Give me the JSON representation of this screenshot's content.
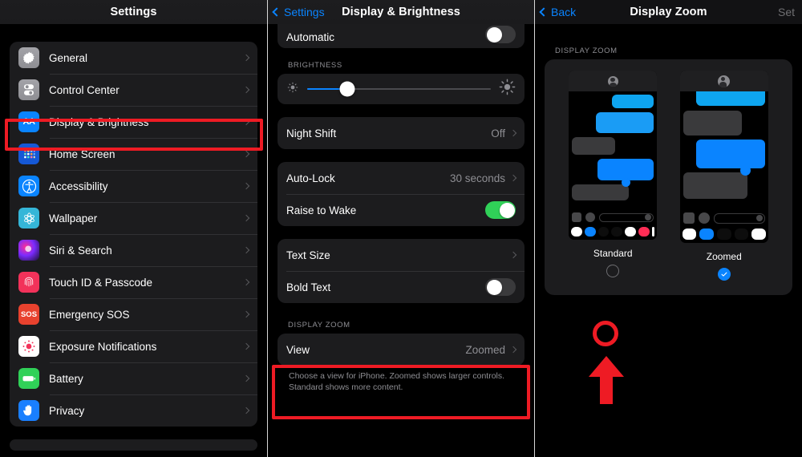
{
  "panel1": {
    "nav": {
      "title": "Settings"
    },
    "items": [
      {
        "label": "General",
        "icon": "gear-icon"
      },
      {
        "label": "Control Center",
        "icon": "control-center-icon"
      },
      {
        "label": "Display & Brightness",
        "icon": "display-brightness-icon",
        "icon_text": "AA",
        "highlighted": true
      },
      {
        "label": "Home Screen",
        "icon": "home-screen-icon"
      },
      {
        "label": "Accessibility",
        "icon": "accessibility-icon"
      },
      {
        "label": "Wallpaper",
        "icon": "wallpaper-icon"
      },
      {
        "label": "Siri & Search",
        "icon": "siri-icon"
      },
      {
        "label": "Touch ID & Passcode",
        "icon": "fingerprint-icon"
      },
      {
        "label": "Emergency SOS",
        "icon": "sos-icon",
        "icon_text": "SOS"
      },
      {
        "label": "Exposure Notifications",
        "icon": "exposure-notifications-icon"
      },
      {
        "label": "Battery",
        "icon": "battery-icon"
      },
      {
        "label": "Privacy",
        "icon": "privacy-hand-icon"
      }
    ]
  },
  "panel2": {
    "nav": {
      "back_label": "Settings",
      "title": "Display & Brightness"
    },
    "automatic": {
      "label": "Automatic",
      "toggle": "off"
    },
    "brightness": {
      "header": "BRIGHTNESS",
      "value_percent": 22,
      "low_icon": "sun-low-icon",
      "high_icon": "sun-high-icon"
    },
    "night_shift": {
      "label": "Night Shift",
      "value": "Off"
    },
    "auto_lock": {
      "label": "Auto-Lock",
      "value": "30 seconds"
    },
    "raise_to_wake": {
      "label": "Raise to Wake",
      "toggle": "on"
    },
    "text_size": {
      "label": "Text Size"
    },
    "bold_text": {
      "label": "Bold Text",
      "toggle": "off"
    },
    "display_zoom": {
      "header": "DISPLAY ZOOM",
      "view_label": "View",
      "view_value": "Zoomed",
      "footnote": "Choose a view for iPhone. Zoomed shows larger controls. Standard shows more content."
    }
  },
  "panel3": {
    "nav": {
      "back_label": "Back",
      "title": "Display Zoom",
      "set_label": "Set"
    },
    "section_header": "DISPLAY ZOOM",
    "options": [
      {
        "label": "Standard",
        "selected": false,
        "annotated": true
      },
      {
        "label": "Zoomed",
        "selected": true,
        "annotated": false
      }
    ]
  },
  "colors": {
    "accent_blue": "#0a84ff",
    "annotation_red": "#ee1b24",
    "toggle_green": "#30d158",
    "panel_bg": "#1c1c1e",
    "screen_bg": "#000000",
    "secondary_text": "#8e8e93"
  }
}
